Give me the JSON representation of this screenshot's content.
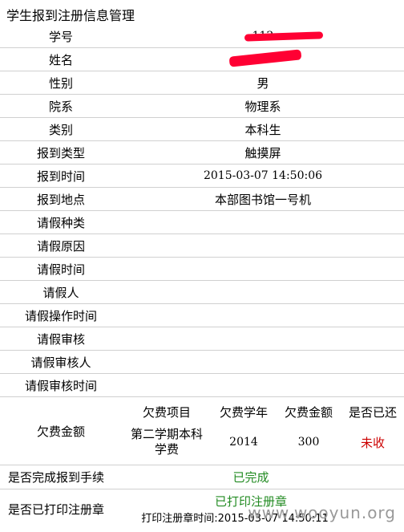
{
  "page_title": "学生报到注册信息管理",
  "rows": [
    {
      "label": "学号",
      "value": "112"
    },
    {
      "label": "姓名",
      "value": ""
    },
    {
      "label": "性别",
      "value": "男"
    },
    {
      "label": "院系",
      "value": "物理系"
    },
    {
      "label": "类别",
      "value": "本科生"
    },
    {
      "label": "报到类型",
      "value": "触摸屏"
    },
    {
      "label": "报到时间",
      "value": "2015-03-07 14:50:06"
    },
    {
      "label": "报到地点",
      "value": "本部图书馆一号机"
    },
    {
      "label": "请假种类",
      "value": ""
    },
    {
      "label": "请假原因",
      "value": ""
    },
    {
      "label": "请假时间",
      "value": ""
    },
    {
      "label": "请假人",
      "value": ""
    },
    {
      "label": "请假操作时间",
      "value": ""
    },
    {
      "label": "请假审核",
      "value": ""
    },
    {
      "label": "请假审核人",
      "value": ""
    },
    {
      "label": "请假审核时间",
      "value": ""
    }
  ],
  "fee": {
    "label": "欠费金额",
    "headers": [
      "欠费项目",
      "欠费学年",
      "欠费金额",
      "是否已还"
    ],
    "row": {
      "item": "第二学期本科学费",
      "year": "2014",
      "amount": "300",
      "status": "未收"
    }
  },
  "completion": {
    "label": "是否完成报到手续",
    "value": "已完成"
  },
  "print": {
    "label": "是否已打印注册章",
    "value": "已打印注册章",
    "time_text": "打印注册章时间:2015-03-07 14:50:11"
  },
  "watermark": "www.wooyun.org",
  "colors": {
    "status_red": "#cc0000",
    "status_green": "#228b22",
    "redaction": "#ff0033"
  }
}
